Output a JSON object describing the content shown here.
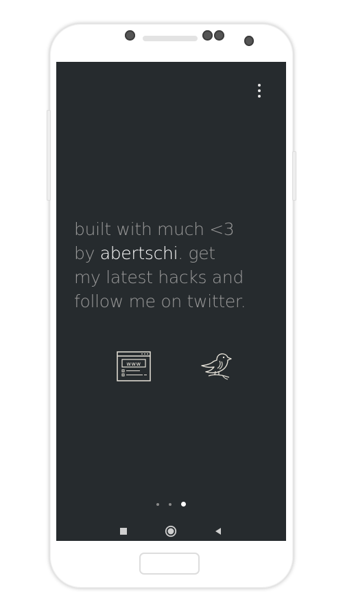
{
  "screen": {
    "background_color": "#262b2e",
    "menu": {
      "icon": "more-vert-icon"
    },
    "message": {
      "line1": "built with much <3",
      "line2_prefix": "by ",
      "line2_handle": "abertschi",
      "line2_suffix": ". get",
      "line3": "my latest hacks and",
      "line4": "follow me on twitter.",
      "text_color": "#9a9a9a",
      "handle_color": "#ffffff"
    },
    "links": [
      {
        "icon": "website-icon",
        "label": "www"
      },
      {
        "icon": "twitter-bird-icon"
      }
    ],
    "pager": {
      "total": 3,
      "active_index": 2
    },
    "navbar": {
      "buttons": [
        "recents-square-icon",
        "home-circle-icon",
        "back-triangle-icon"
      ]
    }
  }
}
